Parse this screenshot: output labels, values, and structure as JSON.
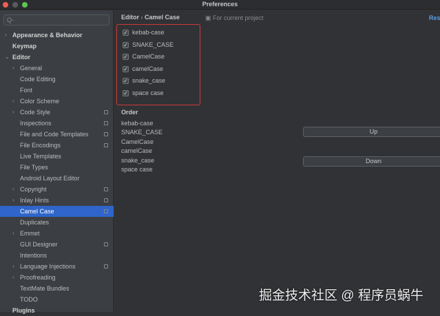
{
  "window": {
    "title": "Preferences"
  },
  "search": {
    "placeholder": "Q-"
  },
  "sidebar": {
    "items": [
      {
        "label": "Appearance & Behavior",
        "level": 0,
        "arrow": ">",
        "bold": true
      },
      {
        "label": "Keymap",
        "level": 0,
        "bold": true
      },
      {
        "label": "Editor",
        "level": 0,
        "arrow": "v",
        "bold": true
      },
      {
        "label": "General",
        "level": 1,
        "arrow": ">"
      },
      {
        "label": "Code Editing",
        "level": 1
      },
      {
        "label": "Font",
        "level": 1
      },
      {
        "label": "Color Scheme",
        "level": 1,
        "arrow": ">"
      },
      {
        "label": "Code Style",
        "level": 1,
        "arrow": ">",
        "project": true
      },
      {
        "label": "Inspections",
        "level": 1,
        "project": true
      },
      {
        "label": "File and Code Templates",
        "level": 1,
        "project": true
      },
      {
        "label": "File Encodings",
        "level": 1,
        "project": true
      },
      {
        "label": "Live Templates",
        "level": 1
      },
      {
        "label": "File Types",
        "level": 1
      },
      {
        "label": "Android Layout Editor",
        "level": 1
      },
      {
        "label": "Copyright",
        "level": 1,
        "arrow": ">",
        "project": true
      },
      {
        "label": "Inlay Hints",
        "level": 1,
        "arrow": ">",
        "project": true
      },
      {
        "label": "Camel Case",
        "level": 1,
        "project": true,
        "selected": true
      },
      {
        "label": "Duplicates",
        "level": 1
      },
      {
        "label": "Emmet",
        "level": 1,
        "arrow": ">"
      },
      {
        "label": "GUI Designer",
        "level": 1,
        "project": true
      },
      {
        "label": "Intentions",
        "level": 1
      },
      {
        "label": "Language Injections",
        "level": 1,
        "arrow": ">",
        "project": true
      },
      {
        "label": "Proofreading",
        "level": 1,
        "arrow": ">"
      },
      {
        "label": "TextMate Bundles",
        "level": 1
      },
      {
        "label": "TODO",
        "level": 1
      },
      {
        "label": "Plugins",
        "level": 0,
        "bold": true
      }
    ]
  },
  "breadcrumb": {
    "parent": "Editor",
    "sep": "›",
    "current": "Camel Case"
  },
  "scope": "For current project",
  "reset": "Reset",
  "checkboxes": [
    {
      "label": "kebab-case",
      "checked": true
    },
    {
      "label": "SNAKE_CASE",
      "checked": true
    },
    {
      "label": "CamelCase",
      "checked": true
    },
    {
      "label": "camelCase",
      "checked": true
    },
    {
      "label": "snake_case",
      "checked": true
    },
    {
      "label": "space case",
      "checked": true
    }
  ],
  "order": {
    "title": "Order",
    "items": [
      "kebab-case",
      "SNAKE_CASE",
      "CamelCase",
      "camelCase",
      "snake_case",
      "space case"
    ],
    "up": "Up",
    "down": "Down"
  },
  "watermark": "掘金技术社区 @ 程序员蜗牛"
}
